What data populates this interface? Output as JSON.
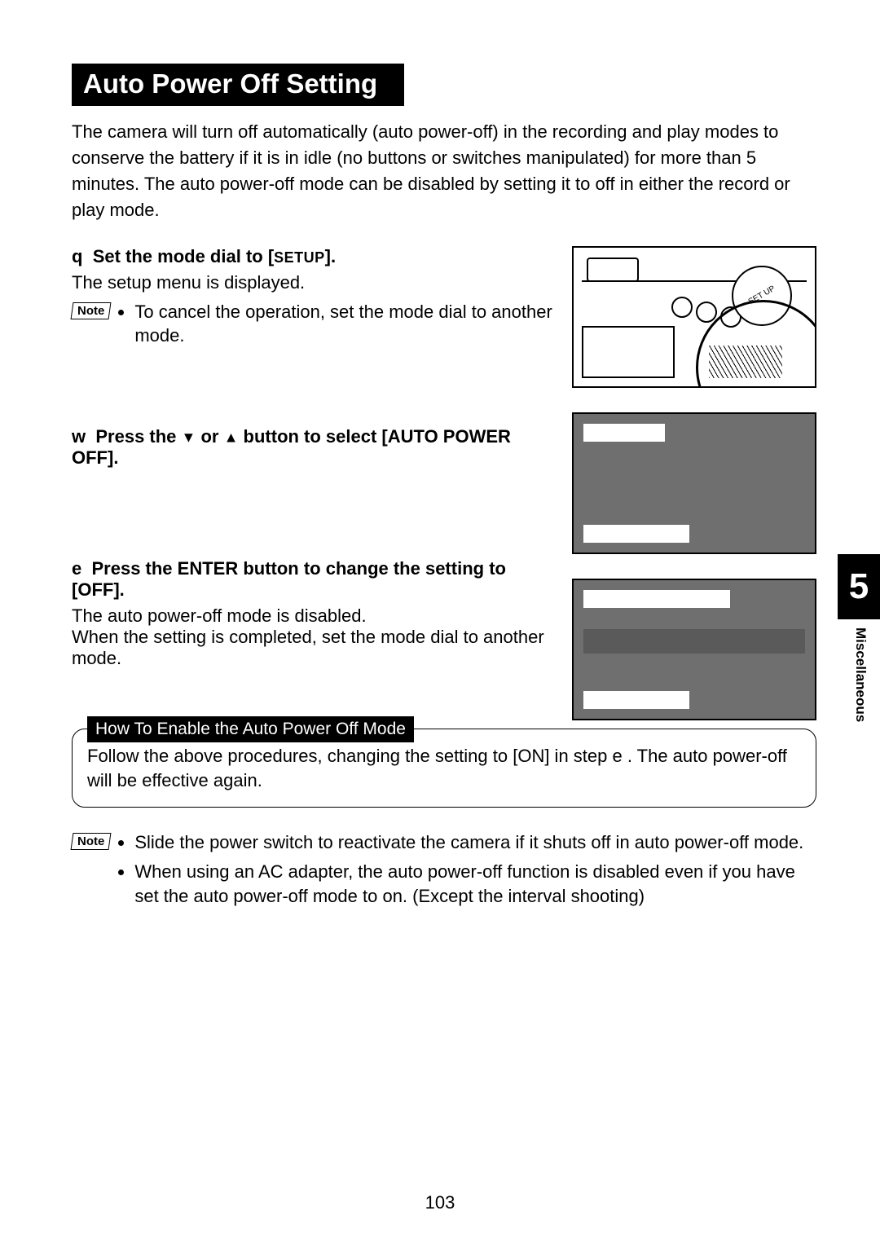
{
  "title": "Auto Power Off Setting",
  "intro": "The camera will turn off automatically (auto power-off) in the recording and play modes to conserve the battery if it is in idle (no buttons or switches manipulated) for more than 5 minutes.  The auto power-off mode can be disabled by setting it to off in either the record or play mode.",
  "step1": {
    "marker": "q",
    "heading_prefix": "Set the mode dial to [",
    "heading_setup": "SETUP",
    "heading_suffix": "].",
    "body": "The setup menu is displayed.",
    "note_label": "Note",
    "note_bullet": "To cancel the operation, set the mode dial to another mode."
  },
  "step2": {
    "marker": "w",
    "heading_a": "Press the ",
    "heading_b": " or ",
    "heading_c": " button to select [AUTO POWER OFF]."
  },
  "step3": {
    "marker": "e",
    "heading": "Press the ENTER button to change the setting to [OFF].",
    "body": "The auto power-off mode is disabled.\nWhen the setting is completed, set the mode dial to another mode."
  },
  "enable": {
    "title": "How To Enable the Auto Power Off Mode",
    "body": "Follow the above procedures, changing the setting to [ON] in step e .  The auto power-off will be effective again."
  },
  "bottom_note": {
    "label": "Note",
    "b1": "Slide the power switch to reactivate the camera if it shuts off in auto power-off mode.",
    "b2": "When using an AC adapter, the auto power-off function is disabled even if you have set the auto power-off mode to on.  (Except the interval shooting)"
  },
  "camera_dial_label": "SET UP",
  "chapter_number": "5",
  "chapter_label": "Miscellaneous",
  "page_number": "103"
}
